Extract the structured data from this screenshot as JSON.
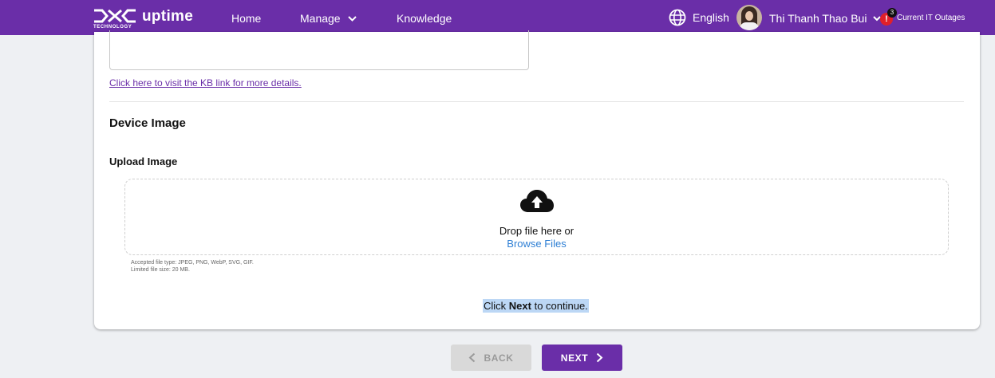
{
  "header": {
    "logo_brand": "DXC",
    "logo_tagline": "TECHNOLOGY",
    "app_name": "uptime",
    "nav": {
      "home": "Home",
      "manage": "Manage",
      "knowledge": "Knowledge"
    },
    "language": "English",
    "user_name": "Thi Thanh Thao Bui",
    "outage_count": "3",
    "outage_alert": "!",
    "outage_label": "Current IT Outages"
  },
  "form": {
    "kb_link": "Click here to visit the KB link for more details.",
    "device_image_title": "Device Image",
    "upload_label": "Upload Image",
    "dropzone": {
      "drop_text": "Drop file here or",
      "browse": "Browse Files"
    },
    "accepted_types": "Accepted file type: JPEG, PNG, WebP, SVG, GIF.",
    "size_limit": "Limited file size: 20 MB.",
    "continue_prefix": "Click ",
    "continue_bold": "Next",
    "continue_suffix": " to continue."
  },
  "footer_buttons": {
    "back": "BACK",
    "next": "NEXT"
  },
  "colors": {
    "brand_purple": "#6a2ea8",
    "link_blue": "#2e7fd4",
    "alert_red": "#e0202a"
  },
  "icons": [
    "globe-icon",
    "chevron-down-icon",
    "cloud-upload-icon",
    "chevron-left-icon",
    "chevron-right-icon"
  ]
}
